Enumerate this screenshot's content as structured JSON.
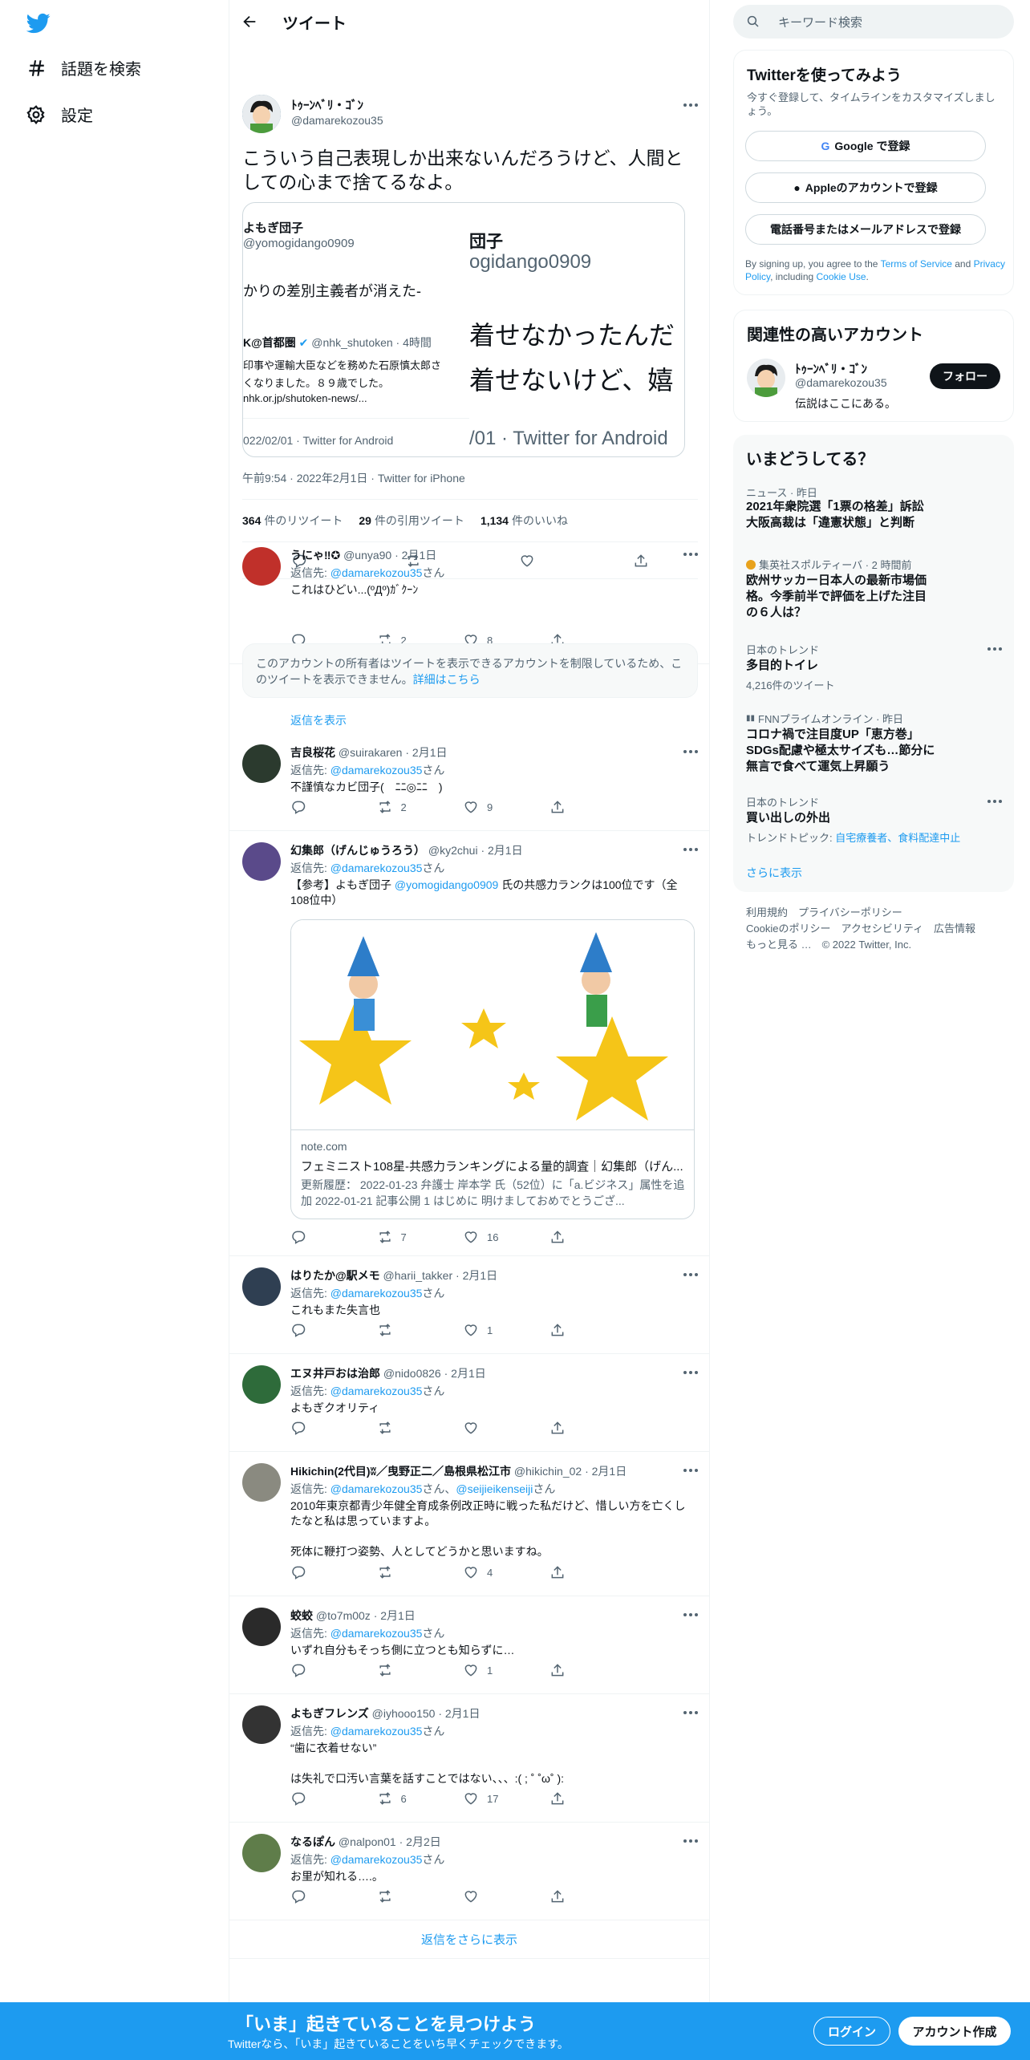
{
  "sidebar": {
    "explore": "話題を検索",
    "settings": "設定"
  },
  "header": {
    "title": "ツイート"
  },
  "main": {
    "name": "ﾄｩｰﾝﾍﾞﾘ・ｺﾞﾝ",
    "handle": "@damarekozou35",
    "text": "こういう自己表現しか出来ないんだろうけど、人間としての心まで捨てるなよ。",
    "quote": {
      "name": "よもぎ団子",
      "handle": "@yomogidango0909",
      "text": "かりの差別主義者が消えた-",
      "inner_name": "K@首都圏",
      "inner_handle": "@nhk_shutoken · 4時間",
      "inner_text1": "印事や運輸大臣などを務めた石原慎太郎さ",
      "inner_text2": "くなりました。８９歳でした。",
      "inner_link": "nhk.or.jp/shutoken-news/...",
      "date": "022/02/01 · Twitter for Android",
      "z_name": "団子",
      "z_handle": "ogidango0909",
      "z_text1": "着せなかったんだ",
      "z_text2": "着せないけど、嬉",
      "z_date": "/01 · Twitter for Android"
    },
    "meta": "午前9:54 · 2022年2月1日 · Twitter for iPhone",
    "retweets": "364",
    "retweets_label": "件のリツイート",
    "quotes": "29",
    "quotes_label": "件の引用ツイート",
    "likes": "1,134",
    "likes_label": "件のいいね"
  },
  "replies": [
    {
      "name": "うにゃ‼✪",
      "handle": "@unya90 · 2月1日",
      "to_label": "返信先: ",
      "to": "@damarekozou35",
      "to_suffix": "さん",
      "text": "これはひどい...(ºДº)ｶﾞｸｰﾝ",
      "rt": "2",
      "like": "8"
    },
    {
      "name": "吉良桜花",
      "handle": "@suirakaren · 2月1日",
      "to_label": "返信先: ",
      "to": "@damarekozou35",
      "to_suffix": "さん",
      "text": "不謹慎なカビ団子(　ﾆﾆ◎ﾆﾆ　)",
      "rt": "2",
      "like": "9"
    },
    {
      "name": "幻集郎（げんじゅうろう）",
      "handle": "@ky2chui · 2月1日",
      "to_label": "返信先: ",
      "to": "@damarekozou35",
      "to_suffix": "さん",
      "text_pre": "【参考】よもぎ団子 ",
      "text_link": "@yomogidango0909",
      "text_post": " 氏の共感力ランクは100位です（全108位中）",
      "card_domain": "note.com",
      "card_title": "フェミニスト108星-共感力ランキングによる量的調査｜幻集郎（げん...",
      "card_desc": "更新履歴： 2022-01-23 弁護士 岸本学 氏（52位）に「a.ビジネス」属性を追加 2022-01-21 記事公開 1 はじめに 明けましておめでとうござ...",
      "rt": "7",
      "like": "16"
    },
    {
      "name": "はりたか@駅メモ",
      "handle": "@harii_takker · 2月1日",
      "to_label": "返信先: ",
      "to": "@damarekozou35",
      "to_suffix": "さん",
      "text": "これもまた失言也",
      "rt": "",
      "like": "1"
    },
    {
      "name": "エヌ井戸おは治郎",
      "handle": "@nido0826 · 2月1日",
      "to_label": "返信先: ",
      "to": "@damarekozou35",
      "to_suffix": "さん",
      "text": "よもぎクオリティ",
      "rt": "",
      "like": ""
    },
    {
      "name": "Hikichin(2代目)ʬ／曳野正二／島根県松江市",
      "handle": "@hikichin_02 · 2月1日",
      "to_label": "返信先: ",
      "to": "@damarekozou35",
      "to_mid": "さん、",
      "to2": "@seijieikenseiji",
      "to_suffix": "さん",
      "text": "2010年東京都青少年健全育成条例改正時に戦った私だけど、惜しい方を亡くしたなと私は思っていますよ。\n\n死体に鞭打つ姿勢、人としてどうかと思いますね。",
      "rt": "",
      "like": "4"
    },
    {
      "name": "蛟蛟",
      "handle": "@to7m00z · 2月1日",
      "to_label": "返信先: ",
      "to": "@damarekozou35",
      "to_suffix": "さん",
      "text": "いずれ自分もそっち側に立つとも知らずに…",
      "rt": "",
      "like": "1"
    },
    {
      "name": "よもぎフレンズ",
      "handle": "@iyhooo150 · 2月1日",
      "to_label": "返信先: ",
      "to": "@damarekozou35",
      "to_suffix": "さん",
      "text": "“歯に衣着せない”\n\nは失礼で口汚い言葉を話すことではない、、、:( ; ˚ ˚ω˚ ):",
      "rt": "6",
      "like": "17"
    },
    {
      "name": "なるぽん",
      "handle": "@nalpon01 · 2月2日",
      "to_label": "返信先: ",
      "to": "@damarekozou35",
      "to_suffix": "さん",
      "text": "お里が知れる….。",
      "rt": "",
      "like": ""
    }
  ],
  "restricted": {
    "text": "このアカウントの所有者はツイートを表示できるアカウントを制限しているため、このツイートを表示できません。",
    "link": "詳細はこちら",
    "show": "返信を表示"
  },
  "more_replies": "返信をさらに表示",
  "right": {
    "search_placeholder": "キーワード検索",
    "signup": {
      "title": "Twitterを使ってみよう",
      "sub": "今すぐ登録して、タイムラインをカスタマイズしましょう。",
      "google": "Google で登録",
      "apple": "Appleのアカウントで登録",
      "phone": "電話番号またはメールアドレスで登録",
      "terms_pre": "By signing up, you agree to the ",
      "terms_link": "Terms of Service",
      "terms_mid": " and ",
      "privacy_link": "Privacy Policy",
      "terms_mid2": ", including ",
      "cookie_link": "Cookie Use",
      "terms_end": "."
    },
    "related": {
      "title": "関連性の高いアカウント",
      "name": "ﾄｩｰﾝﾍﾞﾘ・ｺﾞﾝ",
      "handle": "@damarekozou35",
      "bio": "伝説はここにある。",
      "follow": "フォロー"
    },
    "trends": {
      "title": "いまどうしてる？",
      "items": [
        {
          "meta": "ニュース · 昨日",
          "title": "2021年衆院選「1票の格差」訴訟 大阪高裁は「違憲状態」と判断"
        },
        {
          "meta": "集英社スポルティーバ · 2 時間前",
          "title": "欧州サッカー日本人の最新市場価格。今季前半で評価を上げた注目の６人は？"
        },
        {
          "meta": "日本のトレンド",
          "title": "多目的トイレ",
          "sub": "4,216件のツイート"
        },
        {
          "meta": "FNNプライムオンライン · 昨日",
          "title": "コロナ禍で注目度UP「恵方巻」SDGs配慮や極太サイズも…節分に無言で食べて運気上昇願う"
        },
        {
          "meta": "日本のトレンド",
          "title": "買い出しの外出",
          "sub_pre": "トレンドトピック: ",
          "sub_link": "自宅療養者、食料配達中止"
        }
      ],
      "more": "さらに表示"
    },
    "footer": {
      "l1": "利用規約　プライバシーポリシー",
      "l2": "Cookieのポリシー　アクセシビリティ　広告情報",
      "l3": "もっと見る …　© 2022 Twitter, Inc."
    }
  },
  "banner": {
    "title": "「いま」起きていることを見つけよう",
    "sub": "Twitterなら、「いま」起きていることをいち早くチェックできます。",
    "login": "ログイン",
    "signup": "アカウント作成"
  }
}
